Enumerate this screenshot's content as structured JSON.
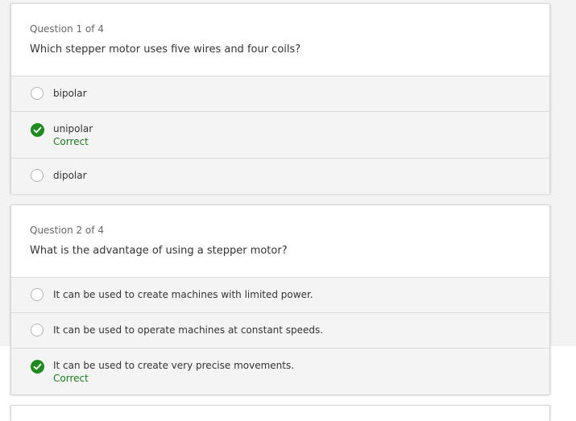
{
  "questions": [
    {
      "counter": "Question 1 of 4",
      "text": "Which stepper motor uses five wires and four coils?",
      "options": [
        {
          "label": "bipolar",
          "selected": false,
          "feedback": ""
        },
        {
          "label": "unipolar",
          "selected": true,
          "feedback": "Correct"
        },
        {
          "label": "dipolar",
          "selected": false,
          "feedback": ""
        }
      ]
    },
    {
      "counter": "Question 2 of 4",
      "text": "What is the advantage of using a stepper motor?",
      "options": [
        {
          "label": "It can be used to create machines with limited power.",
          "selected": false,
          "feedback": ""
        },
        {
          "label": "It can be used to operate machines at constant speeds.",
          "selected": false,
          "feedback": ""
        },
        {
          "label": "It can be used to create very precise movements.",
          "selected": true,
          "feedback": "Correct"
        }
      ]
    }
  ],
  "colors": {
    "correct_green": "#1f8a1f",
    "option_bg": "#f4f4f4",
    "card_bg": "#ffffff"
  },
  "icons": {
    "selected": "check-circle-icon",
    "unselected": "radio-empty-icon"
  }
}
